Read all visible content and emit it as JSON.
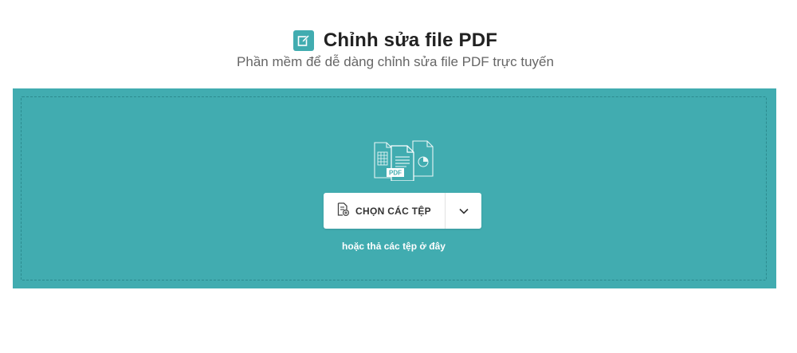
{
  "header": {
    "title": "Chỉnh sửa file PDF",
    "subtitle": "Phần mềm để dễ dàng chỉnh sửa file PDF trực tuyến",
    "icon": "edit-icon"
  },
  "dropzone": {
    "badge_text": "PDF",
    "choose_label": "CHỌN CÁC TỆP",
    "choose_icon": "file-add-icon",
    "dropdown_icon": "chevron-down-icon",
    "hint": "hoặc thả các tệp ở đây"
  },
  "colors": {
    "accent": "#41acb0",
    "dashed_border": "#2c8a8e"
  }
}
